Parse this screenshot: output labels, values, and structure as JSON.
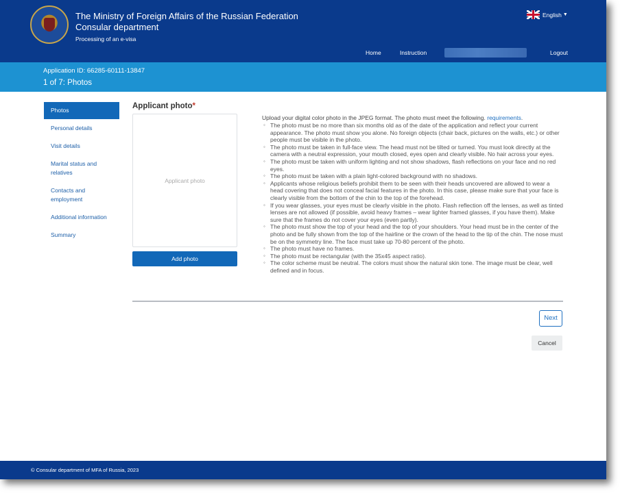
{
  "header": {
    "ministry": "The Ministry of Foreign Affairs of the Russian Federation",
    "department": "Consular department",
    "subtitle": "Processing of an e-visa",
    "language": "English",
    "logo_icon": "coat-of-arms-icon",
    "flag_icon": "uk-flag-icon"
  },
  "nav": {
    "home": "Home",
    "instruction": "Instruction",
    "logout": "Logout"
  },
  "application": {
    "id_label": "Application ID: 66285-60111-13847",
    "step": "1 of 7: Photos"
  },
  "sidebar": {
    "items": [
      {
        "label": "Photos"
      },
      {
        "label": "Personal details"
      },
      {
        "label": "Visit details"
      },
      {
        "label": "Marital status and relatives"
      },
      {
        "label": "Contacts and employment"
      },
      {
        "label": "Additional information"
      },
      {
        "label": "Summary"
      }
    ]
  },
  "photo": {
    "title": "Applicant photo",
    "required_mark": "*",
    "placeholder": "Applicant photo",
    "add_button": "Add photo"
  },
  "requirements": {
    "intro": "Upload your digital color photo in the JPEG format. The photo must meet the following",
    "intro_link": "requirements",
    "items": [
      "The photo must be no more than six months old as of the date of the application and reflect your current appearance. The photo must show you alone. No foreign objects (chair back, pictures on the walls, etc.) or other people must be visible in the photo.",
      "The photo must be taken in full-face view. The head must not be tilted or turned. You must look directly at the camera with a neutral expression, your mouth closed, eyes open and clearly visible. No hair across your eyes.",
      "The photo must be taken with uniform lighting and not show shadows, flash reflections on your face and no red eyes.",
      "The photo must be taken with a plain light-colored background with no shadows.",
      "Applicants whose religious beliefs prohibit them to be seen with their heads uncovered are allowed to wear a head covering that does not conceal facial features in the photo. In this case, please make sure that your face is clearly visible from the bottom of the chin to the top of the forehead.",
      "If you wear glasses, your eyes must be clearly visible in the photo. Flash reflection off the lenses, as well as tinted lenses are not allowed (if possible, avoid heavy frames – wear lighter framed glasses, if you have them). Make sure that the frames do not cover your eyes (even partly).",
      "The photo must show the top of your head and the top of your shoulders. Your head must be in the center of the photo and be fully shown from the top of the hairline or the crown of the head to the tip of the chin. The nose must be on the symmetry line. The face must take up 70-80 percent of the photo.",
      "The photo must have no frames.",
      "The photo must be rectangular (with the 35x45 aspect ratio).",
      "The color scheme must be neutral. The colors must show the natural skin tone. The image must be clear, well defined and in focus."
    ]
  },
  "actions": {
    "next": "Next",
    "cancel": "Cancel"
  },
  "footer": {
    "copyright": "© Consular department of MFA of Russia, 2023"
  },
  "colors": {
    "header": "#0a3a8c",
    "band": "#1d92d2",
    "primary_button": "#1268b8",
    "link": "#1d6fc0"
  }
}
